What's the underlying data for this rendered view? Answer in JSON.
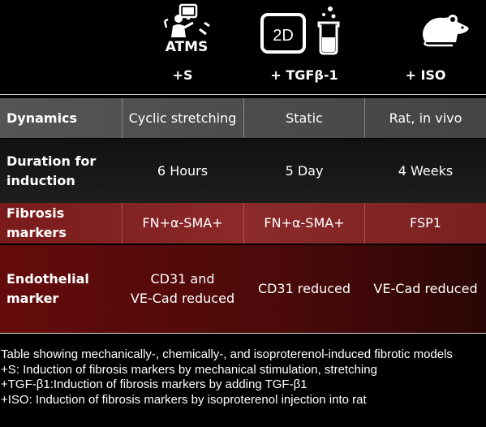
{
  "header": {
    "atms_label": "ATMS",
    "label_2d": "2D",
    "col1": "+S",
    "col2": "+ TGFβ-1",
    "col3": "+ ISO"
  },
  "icons": [
    "scientist-with-computer-icon",
    "2d-culture-icon",
    "flask-icon",
    "rat-icon"
  ],
  "rows": [
    {
      "label": "Dynamics",
      "c1": "Cyclic stretching",
      "c2": "Static",
      "c3": "Rat, in vivo"
    },
    {
      "label_line1": "Duration for",
      "label_line2": "induction",
      "c1": "6 Hours",
      "c2": "5 Day",
      "c3": "4 Weeks"
    },
    {
      "label": "Fibrosis markers",
      "c1": "FN+α-SMA+",
      "c2": "FN+α-SMA+",
      "c3": "FSP1"
    },
    {
      "label_line1": "Endothelial",
      "label_line2": "marker",
      "c1_line1": "CD31 and",
      "c1_line2": "VE-Cad reduced",
      "c2": "CD31 reduced",
      "c3": "VE-Cad reduced"
    }
  ],
  "caption": {
    "line1": "Table showing mechanically-, chemically-, and isoproterenol-induced fibrotic models",
    "line2": "+S: Induction of fibrosis markers by mechanical stimulation, stretching",
    "line3": "+TGF-β1:Induction of fibrosis markers by adding TGF-β1",
    "line4": "+ISO: Induction of fibrosis markers by isoproterenol injection into rat"
  },
  "colors": {
    "background": "#000000",
    "grey_row": "#555555",
    "red_row": "#8c2a2a",
    "dark_red_row": "#650b0b"
  }
}
